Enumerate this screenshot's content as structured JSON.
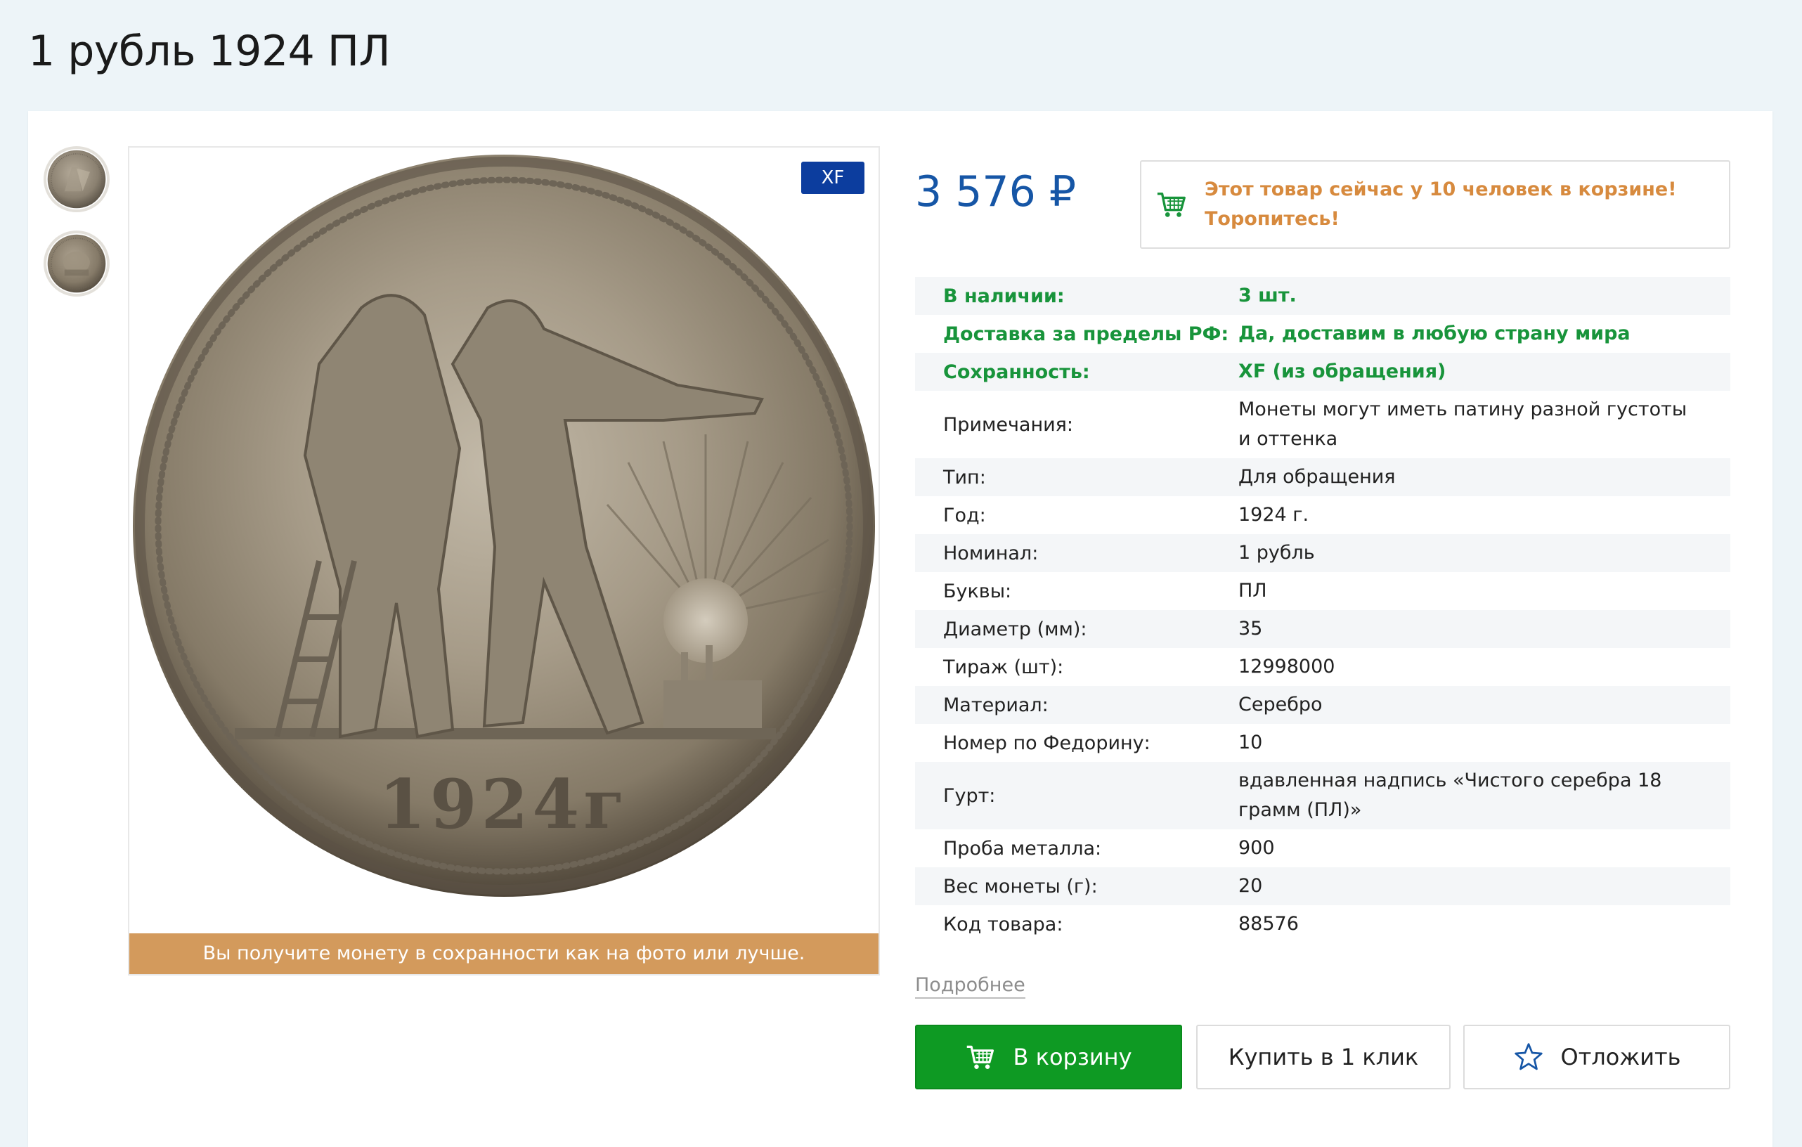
{
  "page": {
    "title": "1 рубль 1924 ПЛ"
  },
  "gallery": {
    "thumbnails": [
      "coin-reverse-thumb",
      "coin-obverse-thumb"
    ],
    "grade_badge": "XF",
    "photo_note": "Вы получите монету в сохранности как на фото или лучше.",
    "coin_year_text": "1924г"
  },
  "product": {
    "price": "3 576 ₽",
    "cart_alert_line1": "Этот товар сейчас у 10 человек в корзине!",
    "cart_alert_line2": "Торопитесь!",
    "specs": [
      {
        "key": "В наличии:",
        "value": "3 шт."
      },
      {
        "key": "Доставка за пределы РФ:",
        "value": "Да, доставим в любую страну мира"
      },
      {
        "key": "Сохранность:",
        "value": "XF (из обращения)"
      },
      {
        "key": "Примечания:",
        "value": "Монеты могут иметь патину разной густоты и оттенка"
      },
      {
        "key": "Тип:",
        "value": "Для обращения"
      },
      {
        "key": "Год:",
        "value": "1924 г."
      },
      {
        "key": "Номинал:",
        "value": "1 рубль"
      },
      {
        "key": "Буквы:",
        "value": "ПЛ"
      },
      {
        "key": "Диаметр (мм):",
        "value": "35"
      },
      {
        "key": "Тираж (шт):",
        "value": "12998000"
      },
      {
        "key": "Материал:",
        "value": "Серебро"
      },
      {
        "key": "Номер по Федорину:",
        "value": "10"
      },
      {
        "key": "Гурт:",
        "value": "вдавленная надпись «Чистого серебра 18 грамм (ПЛ)»"
      },
      {
        "key": "Проба металла:",
        "value": "900"
      },
      {
        "key": "Вес монеты (г):",
        "value": "20"
      },
      {
        "key": "Код товара:",
        "value": "88576"
      }
    ],
    "more_link": "Подробнее"
  },
  "actions": {
    "add_to_cart": "В корзину",
    "buy_one_click": "Купить в 1 клик",
    "save_for_later": "Отложить"
  },
  "colors": {
    "price": "#1656a6",
    "highlight": "#18943b",
    "alert": "#d78a3e",
    "cart_button": "#0e9a23",
    "badge": "#0c3d9e",
    "note_bar": "#d39a5c"
  },
  "icons": {
    "cart_alert": "cart-icon",
    "cart_button": "cart-icon",
    "later_button": "star-icon"
  }
}
